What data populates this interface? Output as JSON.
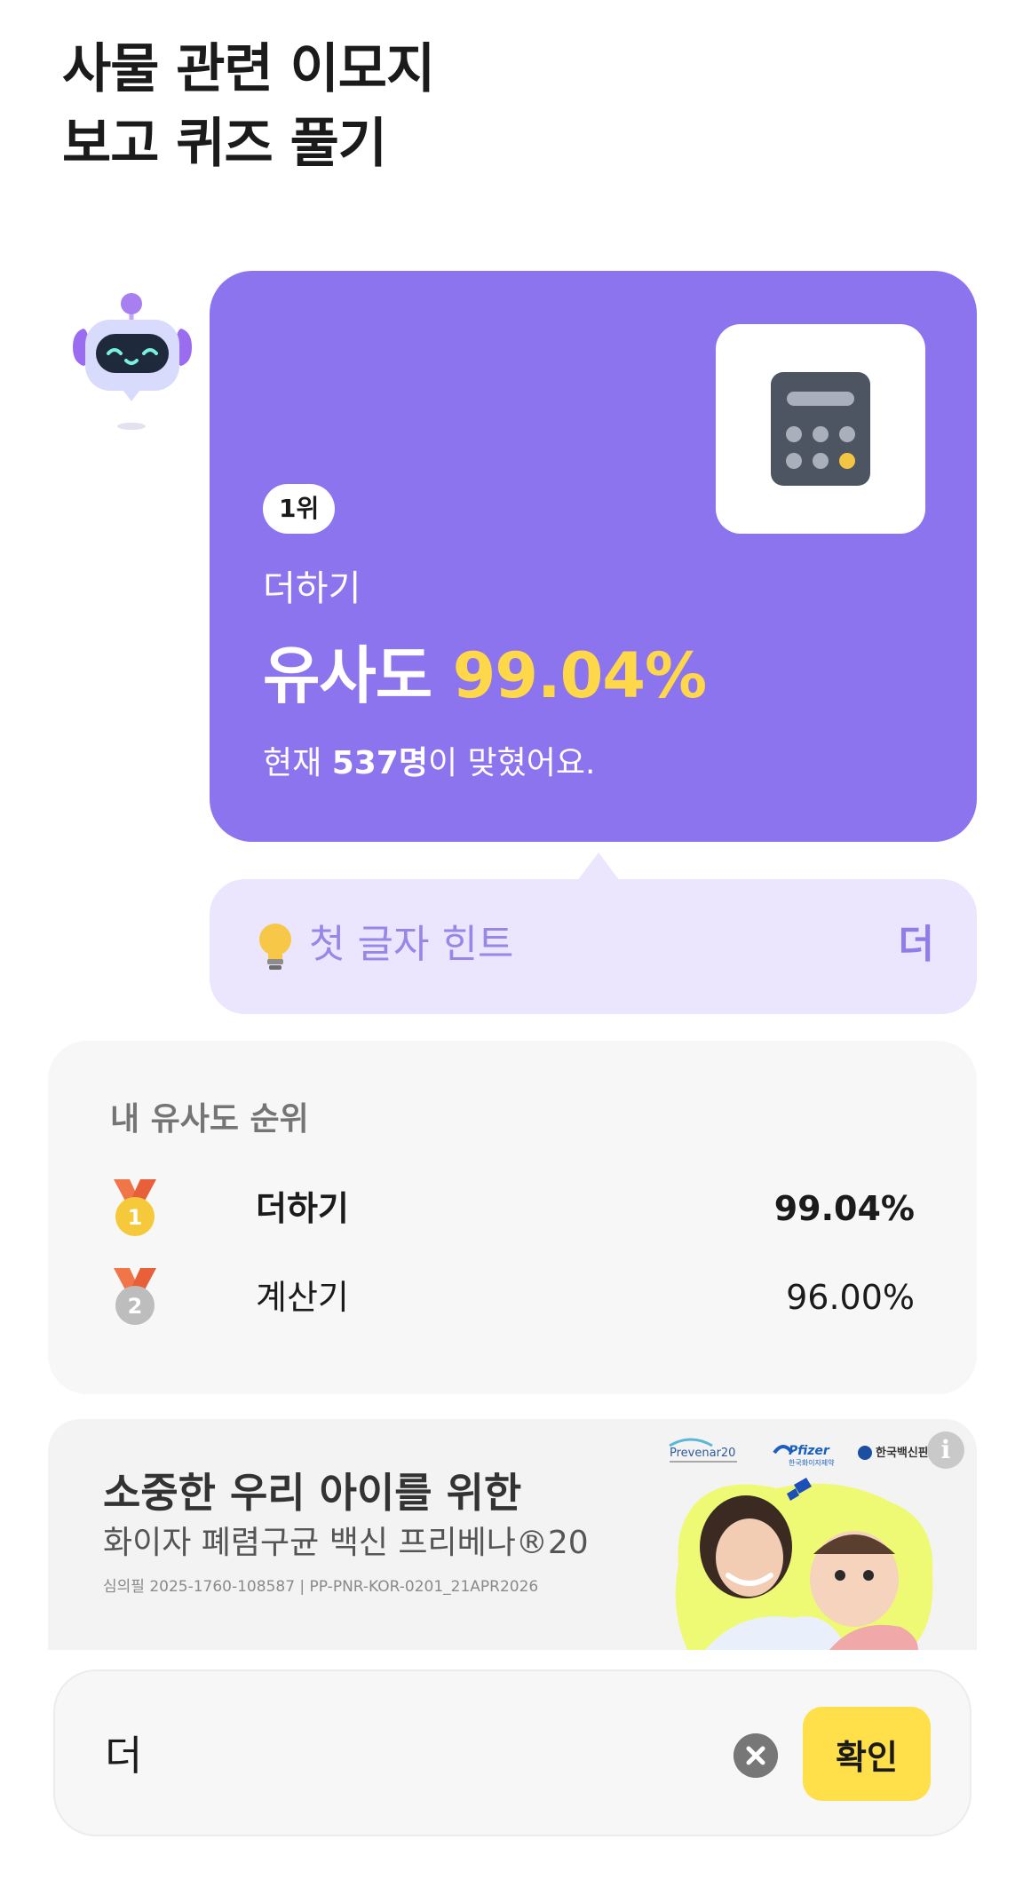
{
  "page": {
    "title_line1": "사물 관련 이모지",
    "title_line2": "보고 퀴즈 풀기"
  },
  "result": {
    "emoji_icon": "calculator-icon",
    "rank_badge": "1위",
    "guess_word": "더하기",
    "similarity_label": "유사도",
    "similarity_value": "99.04%",
    "solved_prefix": "현재",
    "solved_count": "537명",
    "solved_suffix": "이 맞혔어요."
  },
  "hint": {
    "icon": "lightbulb-icon",
    "label": "첫 글자 힌트",
    "value": "더"
  },
  "ranking": {
    "title": "내 유사도 순위",
    "rows": [
      {
        "medal_number": "1",
        "word": "더하기",
        "score": "99.04%",
        "medal_color": "#f6c93a"
      },
      {
        "medal_number": "2",
        "word": "계산기",
        "score": "96.00%",
        "medal_color": "#bdbdbd"
      }
    ]
  },
  "ad": {
    "headline": "소중한 우리 아이를 위한",
    "subline": "화이자 폐렴구균 백신 프리베나®20",
    "legal": "심의필 2025-1760-108587 | PP-PNR-KOR-0201_21APR2026",
    "brand_prevenar": "Prevenar20",
    "brand_pfizer": "Pfizer",
    "brand_pfizer_sub": "한국화이자제약",
    "brand_vaccine": "한국백신판매(주)",
    "info_icon": "i"
  },
  "input": {
    "value": "더",
    "confirm_label": "확인"
  },
  "colors": {
    "accent_purple": "#8d74ef",
    "hint_bg": "#ebe6fd",
    "highlight_yellow": "#ffd84a",
    "confirm_yellow": "#ffe04a"
  }
}
